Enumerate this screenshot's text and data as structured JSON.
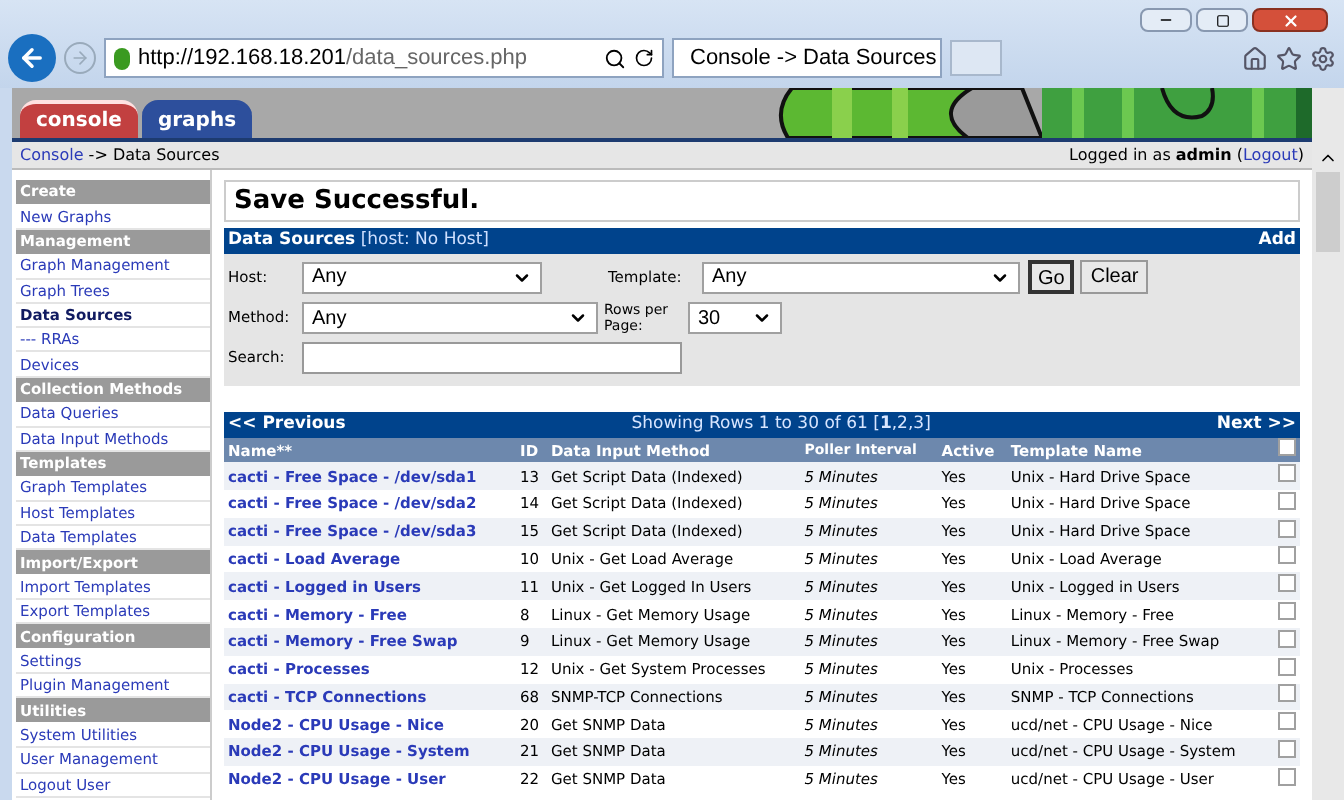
{
  "browser": {
    "url_host": "http://192.168.18.201",
    "url_path": "/data_sources.php",
    "tab_title": "Console -> Data Sources"
  },
  "nav_tabs": [
    {
      "label": "console",
      "selected": true
    },
    {
      "label": "graphs",
      "selected": false
    }
  ],
  "breadcrumb": {
    "link": "Console",
    "rest": " -> Data Sources"
  },
  "login": {
    "prefix": "Logged in as ",
    "user": "admin",
    "logout": "Logout",
    "open": " (",
    "close": ")"
  },
  "sidebar": [
    {
      "kind": "header",
      "label": "Create"
    },
    {
      "kind": "link",
      "label": "New Graphs",
      "selected": false
    },
    {
      "kind": "header",
      "label": "Management"
    },
    {
      "kind": "link",
      "label": "Graph Management",
      "selected": false
    },
    {
      "kind": "link",
      "label": "Graph Trees",
      "selected": false
    },
    {
      "kind": "link",
      "label": "Data Sources",
      "selected": true
    },
    {
      "kind": "link",
      "label": "--- RRAs",
      "selected": false
    },
    {
      "kind": "link",
      "label": "Devices",
      "selected": false
    },
    {
      "kind": "header",
      "label": "Collection Methods"
    },
    {
      "kind": "link",
      "label": "Data Queries",
      "selected": false
    },
    {
      "kind": "link",
      "label": "Data Input Methods",
      "selected": false
    },
    {
      "kind": "header",
      "label": "Templates"
    },
    {
      "kind": "link",
      "label": "Graph Templates",
      "selected": false
    },
    {
      "kind": "link",
      "label": "Host Templates",
      "selected": false
    },
    {
      "kind": "link",
      "label": "Data Templates",
      "selected": false
    },
    {
      "kind": "header",
      "label": "Import/Export"
    },
    {
      "kind": "link",
      "label": "Import Templates",
      "selected": false
    },
    {
      "kind": "link",
      "label": "Export Templates",
      "selected": false
    },
    {
      "kind": "header",
      "label": "Configuration"
    },
    {
      "kind": "link",
      "label": "Settings",
      "selected": false
    },
    {
      "kind": "link",
      "label": "Plugin Management",
      "selected": false
    },
    {
      "kind": "header",
      "label": "Utilities"
    },
    {
      "kind": "link",
      "label": "System Utilities",
      "selected": false
    },
    {
      "kind": "link",
      "label": "User Management",
      "selected": false
    },
    {
      "kind": "link",
      "label": "Logout User",
      "selected": false
    }
  ],
  "message": "Save Successful.",
  "filter": {
    "title": "Data Sources",
    "subtitle": "[host: No Host]",
    "add": "Add",
    "host_label": "Host:",
    "host_value": "Any",
    "template_label": "Template:",
    "template_value": "Any",
    "go": "Go",
    "clear": "Clear",
    "method_label": "Method:",
    "method_value": "Any",
    "rows_label": "Rows per Page:",
    "rows_value": "30",
    "search_label": "Search:"
  },
  "pager": {
    "previous": "<< Previous",
    "showing": "Showing Rows 1 to 30 of 61 [**1**,2,3]",
    "next": "Next >>"
  },
  "table": {
    "columns": [
      "Name**",
      "ID",
      "Data Input Method",
      "Poller Interval",
      "Active",
      "Template Name"
    ],
    "select_all": false,
    "rows": [
      {
        "name": "cacti - Free Space - /dev/sda1",
        "id": "13",
        "method": "Get Script Data (Indexed)",
        "interval": "5 Minutes",
        "active": "Yes",
        "template": "Unix - Hard Drive Space",
        "checked": false
      },
      {
        "name": "cacti - Free Space - /dev/sda2",
        "id": "14",
        "method": "Get Script Data (Indexed)",
        "interval": "5 Minutes",
        "active": "Yes",
        "template": "Unix - Hard Drive Space",
        "checked": false
      },
      {
        "name": "cacti - Free Space - /dev/sda3",
        "id": "15",
        "method": "Get Script Data (Indexed)",
        "interval": "5 Minutes",
        "active": "Yes",
        "template": "Unix - Hard Drive Space",
        "checked": false
      },
      {
        "name": "cacti - Load Average",
        "id": "10",
        "method": "Unix - Get Load Average",
        "interval": "5 Minutes",
        "active": "Yes",
        "template": "Unix - Load Average",
        "checked": false
      },
      {
        "name": "cacti - Logged in Users",
        "id": "11",
        "method": "Unix - Get Logged In Users",
        "interval": "5 Minutes",
        "active": "Yes",
        "template": "Unix - Logged in Users",
        "checked": false
      },
      {
        "name": "cacti - Memory - Free",
        "id": "8",
        "method": "Linux - Get Memory Usage",
        "interval": "5 Minutes",
        "active": "Yes",
        "template": "Linux - Memory - Free",
        "checked": false
      },
      {
        "name": "cacti - Memory - Free Swap",
        "id": "9",
        "method": "Linux - Get Memory Usage",
        "interval": "5 Minutes",
        "active": "Yes",
        "template": "Linux - Memory - Free Swap",
        "checked": false
      },
      {
        "name": "cacti - Processes",
        "id": "12",
        "method": "Unix - Get System Processes",
        "interval": "5 Minutes",
        "active": "Yes",
        "template": "Unix - Processes",
        "checked": false
      },
      {
        "name": "cacti - TCP Connections",
        "id": "68",
        "method": "SNMP-TCP Connections",
        "interval": "5 Minutes",
        "active": "Yes",
        "template": "SNMP - TCP Connections",
        "checked": false
      },
      {
        "name": "Node2 - CPU Usage - Nice",
        "id": "20",
        "method": "Get SNMP Data",
        "interval": "5 Minutes",
        "active": "Yes",
        "template": "ucd/net - CPU Usage - Nice",
        "checked": false
      },
      {
        "name": "Node2 - CPU Usage - System",
        "id": "21",
        "method": "Get SNMP Data",
        "interval": "5 Minutes",
        "active": "Yes",
        "template": "ucd/net - CPU Usage - System",
        "checked": false
      },
      {
        "name": "Node2 - CPU Usage - User",
        "id": "22",
        "method": "Get SNMP Data",
        "interval": "5 Minutes",
        "active": "Yes",
        "template": "ucd/net - CPU Usage - User",
        "checked": false
      }
    ]
  }
}
